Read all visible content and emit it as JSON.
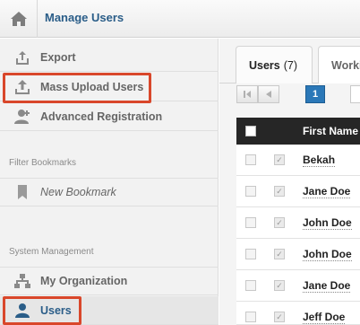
{
  "header": {
    "breadcrumb": "Manage Users"
  },
  "sidebar": {
    "items_top": [
      {
        "label": "Export",
        "icon": "export-icon"
      },
      {
        "label": "Mass Upload Users",
        "icon": "upload-icon",
        "highlighted": true
      },
      {
        "label": "Advanced Registration",
        "icon": "user-add-icon"
      }
    ],
    "filter_section": {
      "title": "Filter Bookmarks",
      "items": [
        {
          "label": "New Bookmark",
          "icon": "bookmark-icon"
        }
      ]
    },
    "system_section": {
      "title": "System Management",
      "items": [
        {
          "label": "My Organization",
          "icon": "org-chart-icon"
        },
        {
          "label": "Users",
          "icon": "user-icon",
          "active": true,
          "highlighted": true
        }
      ]
    }
  },
  "main": {
    "tabs": [
      {
        "label": "Users",
        "count": "(7)",
        "active": true
      },
      {
        "label": "Worki",
        "active": false
      }
    ],
    "pager": {
      "current_page": "1"
    },
    "table": {
      "column_header": "First Name",
      "rows": [
        {
          "first_name": "Bekah"
        },
        {
          "first_name": "Jane Doe"
        },
        {
          "first_name": "John Doe"
        },
        {
          "first_name": "John Doe"
        },
        {
          "first_name": "Jane Doe"
        },
        {
          "first_name": "Jeff Doe"
        }
      ]
    }
  },
  "colors": {
    "link_blue": "#2a5d88",
    "highlight_red": "#d9472b",
    "pager_active": "#2b78b8",
    "header_dark": "#262626"
  }
}
